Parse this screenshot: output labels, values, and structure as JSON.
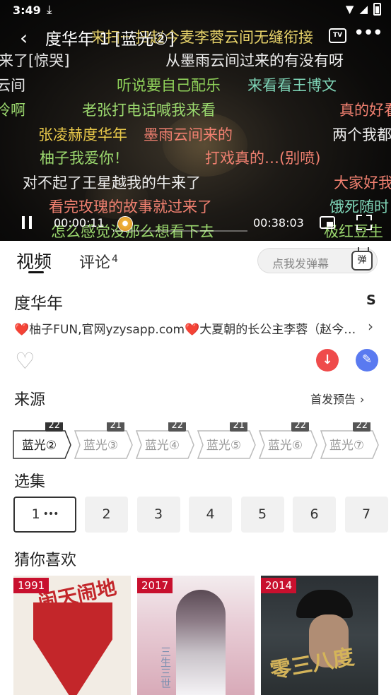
{
  "status_bar": {
    "time": "3:49",
    "download_icon": "⤓"
  },
  "player": {
    "title": "度华年 1 [蓝光②]",
    "current_time": "00:00:11",
    "duration": "00:38:03",
    "progress_fraction": 0.005,
    "danmaku": [
      {
        "text": "来扫一扫赵今麦李蓉云间无缝衔接",
        "color": "#e8d36a"
      },
      {
        "text": "来了[惊哭]",
        "color": "#e6e6e6"
      },
      {
        "text": "从墨雨云间过来的有没有呀",
        "color": "#ececec"
      },
      {
        "text": "云间",
        "color": "#e6e6e6"
      },
      {
        "text": "听说要自己配乐",
        "color": "#8fd15a"
      },
      {
        "text": "来看看王博文",
        "color": "#7fd6b8"
      },
      {
        "text": "冷啊",
        "color": "#9bd86e"
      },
      {
        "text": "老张打电话喊我来看",
        "color": "#9bd86e"
      },
      {
        "text": "真的好看",
        "color": "#f08070"
      },
      {
        "text": "张凌赫度华年",
        "color": "#e8c84a"
      },
      {
        "text": "墨雨云间来的",
        "color": "#f08070"
      },
      {
        "text": "两个我都看",
        "color": "#ececec"
      },
      {
        "text": "柚子我爱你！",
        "color": "#9bd86e"
      },
      {
        "text": "打戏真的…(别喷)",
        "color": "#f08070"
      },
      {
        "text": "对不起了王星越我的牛来了",
        "color": "#ececec"
      },
      {
        "text": "大家好我",
        "color": "#f08070"
      },
      {
        "text": "看完玫瑰的故事就过来了",
        "color": "#f08070"
      },
      {
        "text": "饿死随时",
        "color": "#7fd6b8"
      },
      {
        "text": "怎么感觉没那么想看下去",
        "color": "#9bd86e"
      },
      {
        "text": "极红豆生",
        "color": "#9bd86e"
      }
    ]
  },
  "tabs": {
    "video": "视频",
    "comment": "评论",
    "comment_count": "4"
  },
  "danmu_input": {
    "placeholder": "点我发弹幕",
    "icon_text": "弹"
  },
  "info": {
    "title": "度华年",
    "score_letter": "S",
    "description": "❤️柚子FUN,官网yzysapp.com❤️大夏朝的长公主李蓉（赵今麦饰）与",
    "icons": {
      "like": "heart-icon",
      "download": "download-icon",
      "share": "share-icon"
    }
  },
  "source": {
    "title": "来源",
    "link": "首发预告",
    "chips": [
      {
        "label": "蓝光②",
        "count": "22",
        "active": true
      },
      {
        "label": "蓝光③",
        "count": "21",
        "active": false
      },
      {
        "label": "蓝光④",
        "count": "22",
        "active": false
      },
      {
        "label": "蓝光⑤",
        "count": "21",
        "active": false
      },
      {
        "label": "蓝光⑥",
        "count": "22",
        "active": false
      },
      {
        "label": "蓝光⑦",
        "count": "22",
        "active": false
      }
    ]
  },
  "episodes": {
    "title": "选集",
    "items": [
      "1",
      "2",
      "3",
      "4",
      "5",
      "6",
      "7"
    ],
    "active_dots": "•••"
  },
  "recommend": {
    "title": "猜你喜欢",
    "items": [
      {
        "year": "1991",
        "poster_text": "闹天闹地"
      },
      {
        "year": "2017",
        "poster_text": "三生三世"
      },
      {
        "year": "2014",
        "poster_text": "零三八度"
      }
    ]
  }
}
